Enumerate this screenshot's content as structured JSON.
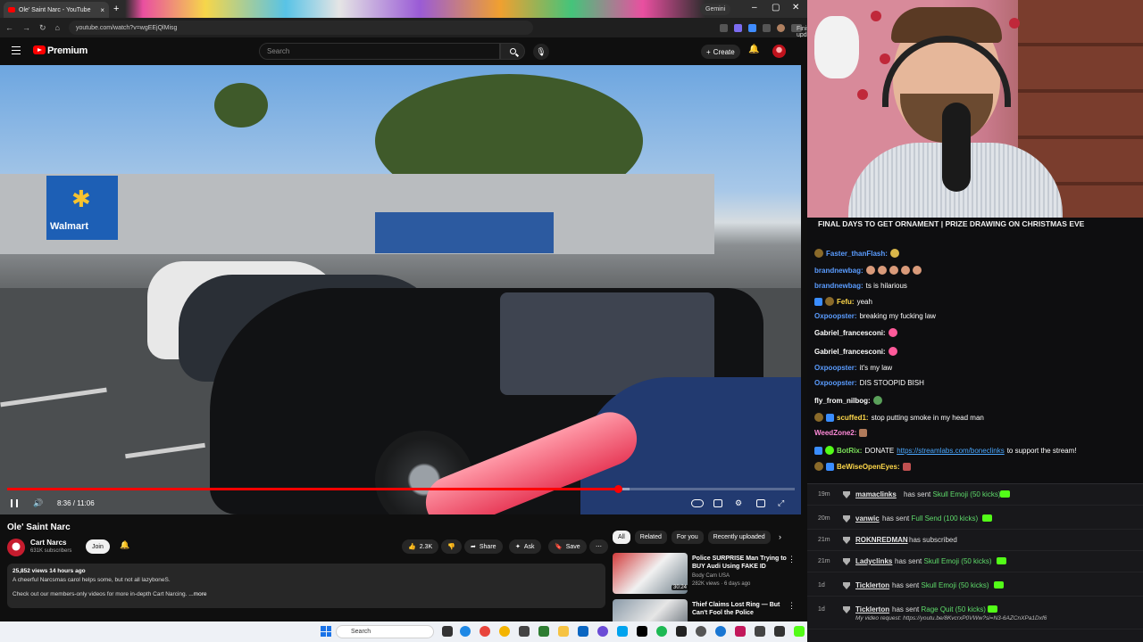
{
  "browser": {
    "tab_title": "Ole' Saint Narc - YouTube",
    "url": "youtube.com/watch?v=wgEEjQlMisg",
    "gemini_label": "Gemini",
    "finish_update": "Finish update"
  },
  "youtube": {
    "brand": "Premium",
    "search_placeholder": "Search",
    "create_label": "Create"
  },
  "player": {
    "time_label": "8:36 / 11:06",
    "progress_fraction": 0.775,
    "buffer_fraction": 0.79
  },
  "video": {
    "title": "Ole' Saint Narc",
    "channel": "Cart Narcs",
    "subscribers": "631K subscribers",
    "join_label": "Join",
    "likes": "2.3K",
    "share_label": "Share",
    "ask_label": "Ask",
    "save_label": "Save",
    "stats": "25,852 views  14 hours ago",
    "desc_line1": "A cheerful Narcsmas carol helps some, but not all lazyboneS.",
    "desc_line2": "Check out our members-only videos for more in-depth Cart Narcing.",
    "more_label": "...more",
    "store_sign": "Walmart"
  },
  "chips": [
    "All",
    "Related",
    "For you",
    "Recently uploaded"
  ],
  "recommendations": [
    {
      "title": "Police SURPRISE Man Trying to BUY Audi Using FAKE ID",
      "channel": "Body Cam USA",
      "meta": "282K views · 6 days ago",
      "duration": "30:24"
    },
    {
      "title": "Thief Claims Lost Ring — But Can't Fool the Police",
      "channel": "",
      "meta": "",
      "duration": ""
    }
  ],
  "taskbar": {
    "search_label": "Search"
  },
  "stream": {
    "banner": "FINAL DAYS TO GET ORNAMENT | PRIZE DRAWING ON CHRISTMAS EVE"
  },
  "chat": [
    {
      "user": "Faster_thanFlash:",
      "text": ""
    },
    {
      "user": "brandnewbag:",
      "text": ""
    },
    {
      "user": "brandnewbag:",
      "text": "ts is hilarious"
    },
    {
      "user": "Fefu:",
      "text": "yeah"
    },
    {
      "user": "Oxpoopster:",
      "text": "breaking my fucking law"
    },
    {
      "user": "Gabriel_francesconi:",
      "text": ""
    },
    {
      "user": "Gabriel_francesconi:",
      "text": ""
    },
    {
      "user": "Oxpoopster:",
      "text": "it's my law"
    },
    {
      "user": "Oxpoopster:",
      "text": "DIS STOOPID BISH"
    },
    {
      "user": "fly_from_nilbog:",
      "text": ""
    },
    {
      "user": "scuffed1:",
      "text": "stop putting smoke in my head man"
    },
    {
      "user": "WeedZone2:",
      "text": ""
    },
    {
      "user": "BotRix:",
      "text": "DONATE",
      "link": "https://streamlabs.com/boneclinks",
      "after": "to support the stream!"
    },
    {
      "user": "BeWiseOpenEyes:",
      "text": ""
    }
  ],
  "alerts": [
    {
      "time": "19m",
      "user": "mamaclinks",
      "text": "has sent",
      "gift": "Skull Emoji (50 kicks)"
    },
    {
      "time": "20m",
      "user": "vanwic",
      "text": "has sent",
      "gift": "Full Send (100 kicks)"
    },
    {
      "time": "21m",
      "user": "ROKNREDMAN",
      "text": "has subscribed",
      "gift": ""
    },
    {
      "time": "21m",
      "user": "Ladyclinks",
      "text": "has sent",
      "gift": "Skull Emoji (50 kicks)"
    },
    {
      "time": "1d",
      "user": "Ticklerton",
      "text": "has sent",
      "gift": "Skull Emoji (50 kicks)"
    },
    {
      "time": "1d",
      "user": "Ticklerton",
      "text": "has sent",
      "gift": "Rage Quit (50 kicks)",
      "sub": "My video request: https://youtu.be/8KvcrxP0VWw?si=N3-6AZCnXPa1Dxf6"
    }
  ]
}
